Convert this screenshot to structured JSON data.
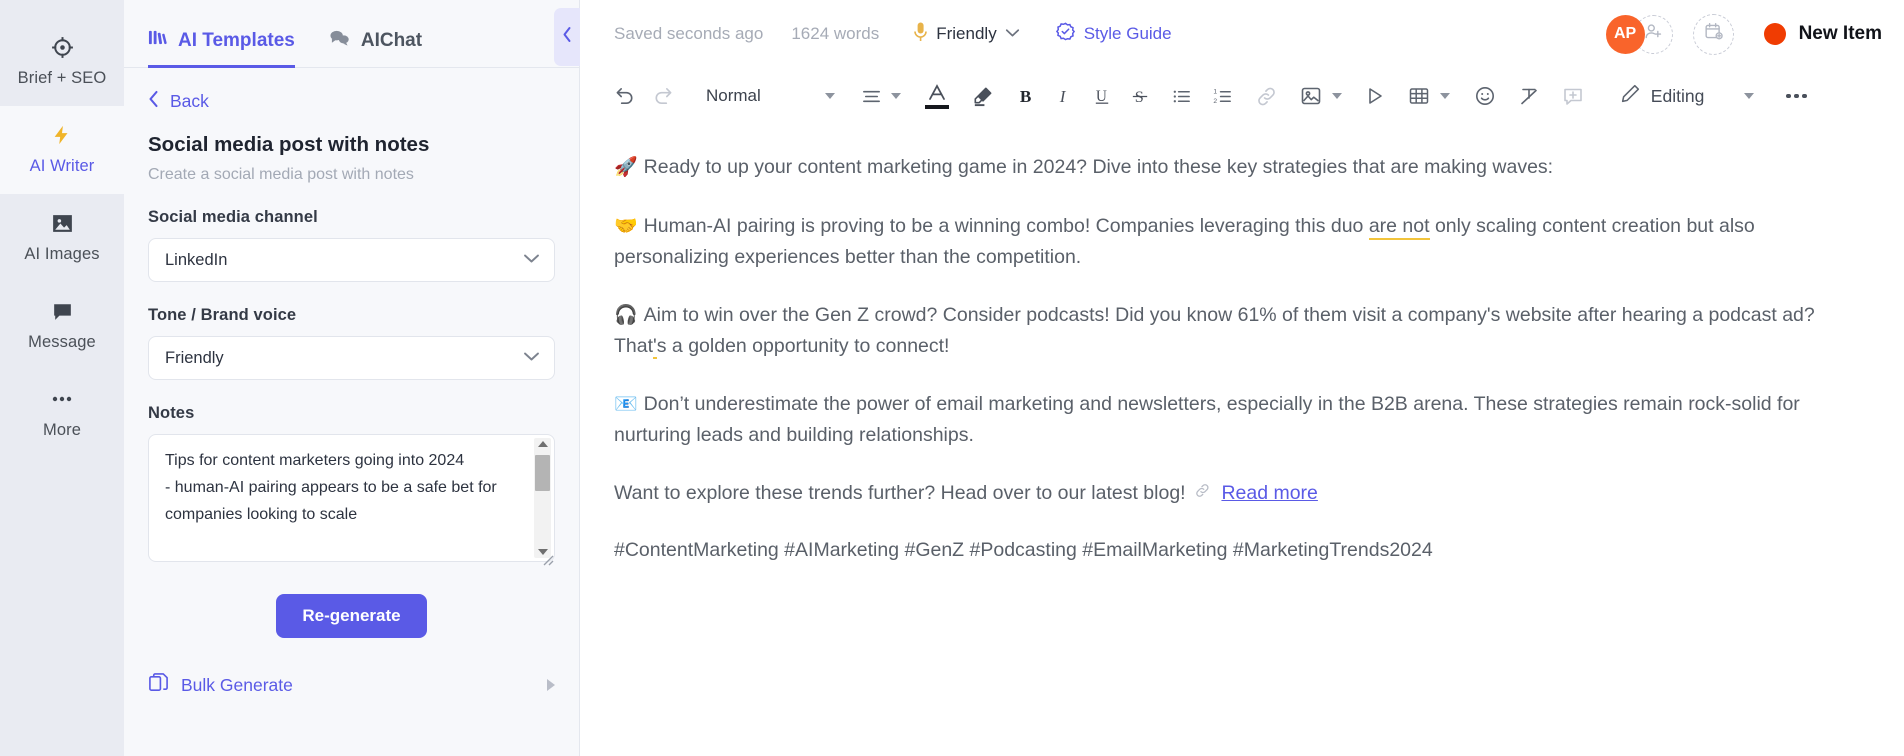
{
  "rail": {
    "items": [
      {
        "label": "Brief + SEO",
        "icon": "target-icon",
        "active": false
      },
      {
        "label": "AI Writer",
        "icon": "lightning-bolt-icon",
        "active": true
      },
      {
        "label": "AI Images",
        "icon": "image-icon",
        "active": false
      },
      {
        "label": "Message",
        "icon": "chat-bubble-icon",
        "active": false
      },
      {
        "label": "More",
        "icon": "ellipsis-icon",
        "active": false
      }
    ]
  },
  "panel": {
    "tabs": [
      {
        "label": "AI Templates",
        "icon": "templates-grid-icon",
        "active": true
      },
      {
        "label": "AIChat",
        "icon": "chat-bubbles-icon",
        "active": false
      }
    ],
    "back_label": "Back",
    "template_title": "Social media post with notes",
    "template_subtitle": "Create a social media post with notes",
    "fields": {
      "channel_label": "Social media channel",
      "channel_value": "LinkedIn",
      "tone_label": "Tone / Brand voice",
      "tone_value": "Friendly",
      "notes_label": "Notes",
      "notes_value": "Tips for content marketers going into 2024\n- human-AI pairing appears to be a safe bet for companies looking to scale"
    },
    "regenerate_label": "Re-generate",
    "bulk_generate_label": "Bulk Generate"
  },
  "topbar": {
    "saved_status": "Saved seconds ago",
    "word_count": "1624 words",
    "voice": "Friendly",
    "style_guide": "Style Guide",
    "avatar_initials": "AP",
    "new_item_label": "New Item",
    "new_item_dot_color": "#f03c02",
    "avatar_color": "#f9642b"
  },
  "toolbar": {
    "undo": "undo-icon",
    "redo": "redo-icon",
    "block_style": "Normal",
    "align": "align-icon",
    "font_color": "font-color-icon",
    "highlight": "highlighter-icon",
    "bold": "B",
    "italic": "I",
    "underline": "U",
    "strikethrough": "S",
    "bullet_list": "bullet-list-icon",
    "numbered_list": "numbered-list-icon",
    "link": "link-icon",
    "image": "image-icon",
    "media": "play-icon",
    "table": "table-icon",
    "emoji": "emoji-icon",
    "clear_format": "clear-formatting-icon",
    "comment": "add-comment-icon",
    "mode_label": "Editing",
    "more": "more-horizontal-icon"
  },
  "document": {
    "paragraphs": [
      {
        "emoji": "🚀",
        "pre": "Ready to up your content marketing game in 2024? Dive into these key strategies that are making waves:",
        "mark": "",
        "post": ""
      },
      {
        "emoji": "🤝",
        "pre": "Human-AI pairing is proving to be a winning combo! Companies leveraging this duo ",
        "mark": "are not",
        "post": " only scaling content creation but also personalizing experiences better than the competition."
      },
      {
        "emoji": "🎧",
        "pre": "Aim to win over the Gen Z crowd? Consider podcasts! Did you know 61% of them visit a company's website after hearing a podcast ad? That",
        "mark": "'",
        "post": "s a golden opportunity to connect!"
      },
      {
        "emoji": "📧",
        "pre": "Don’t underestimate the power of email marketing and newsletters, especially in the B2B arena. These strategies remain rock-solid for nurturing leads and building relationships.",
        "mark": "",
        "post": ""
      }
    ],
    "cta_text": "Want to explore these trends further? Head over to our latest blog!",
    "cta_link": "Read more",
    "hashtags": "#ContentMarketing #AIMarketing #GenZ #Podcasting #EmailMarketing #MarketingTrends2024"
  },
  "colors": {
    "accent": "#5a5ae6",
    "rail_bg": "#e9ebf2",
    "panel_bg": "#f7f8fb",
    "grammar_underline": "#f2c43b"
  }
}
